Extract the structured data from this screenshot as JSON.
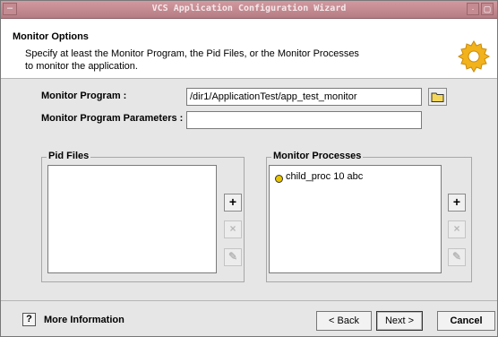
{
  "window": {
    "title": "VCS Application Configuration Wizard",
    "menu_glyph": "–",
    "ctl_min": "·",
    "ctl_max": "▢"
  },
  "header": {
    "title": "Monitor Options",
    "description": "Specify at least the Monitor Program, the Pid Files, or the Monitor Processes to monitor the application."
  },
  "form": {
    "monitor_program": {
      "label": "Monitor Program :",
      "value": "/dir1/ApplicationTest/app_test_monitor"
    },
    "monitor_program_params": {
      "label": "Monitor Program Parameters :",
      "value": ""
    }
  },
  "pid_files": {
    "title": "Pid Files",
    "items": []
  },
  "monitor_processes": {
    "title": "Monitor Processes",
    "items": [
      {
        "label": "child_proc 10 abc",
        "icon": "process-icon"
      }
    ]
  },
  "side_buttons": {
    "add": "+",
    "remove": "×",
    "edit": "✎"
  },
  "footer": {
    "help_glyph": "?",
    "more_info": "More Information",
    "back": "< Back",
    "next": "Next >",
    "cancel": "Cancel"
  },
  "colors": {
    "titlebar": "#b57c84",
    "background": "#e6e6e6",
    "process_icon": "#e8c400"
  }
}
